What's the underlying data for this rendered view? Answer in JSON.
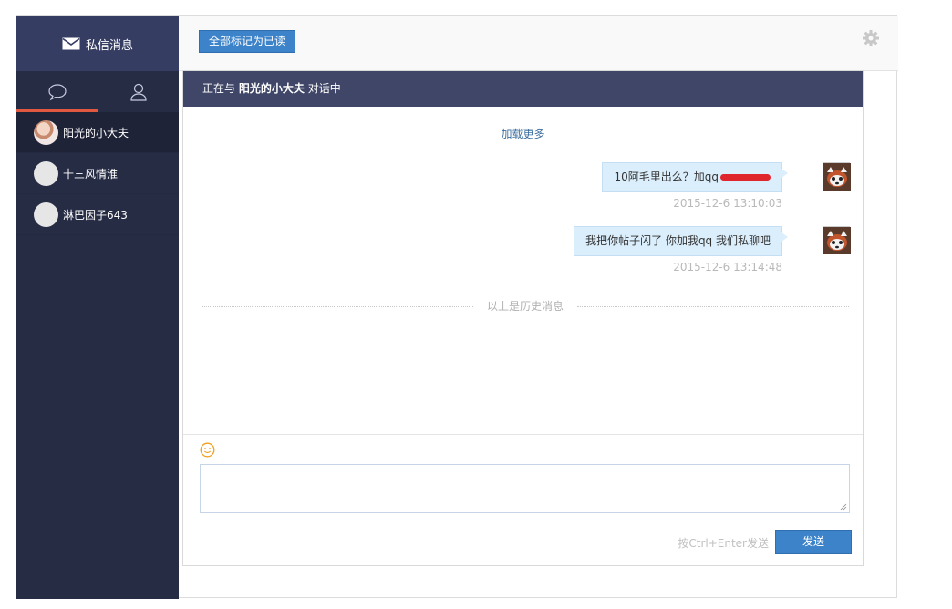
{
  "sidebar": {
    "title": "私信消息",
    "tabs": [
      {
        "icon": "chat-bubble-icon",
        "active": true
      },
      {
        "icon": "user-icon",
        "active": false
      }
    ],
    "contacts": [
      {
        "name": "阳光的小大夫",
        "active": true
      },
      {
        "name": "十三风情淮",
        "active": false
      },
      {
        "name": "淋巴因子643",
        "active": false
      }
    ]
  },
  "toolbar": {
    "mark_all_read": "全部标记为已读",
    "settings_icon": "gear-icon"
  },
  "chat": {
    "header_prefix": "正在与",
    "partner": "阳光的小大夫",
    "header_suffix": "对话中",
    "load_more": "加载更多",
    "messages": [
      {
        "text": "10阿毛里出么？加qq",
        "time": "2015-12-6 13:10:03",
        "redacted": true
      },
      {
        "text": "我把你帖子闪了 你加我qq 我们私聊吧",
        "time": "2015-12-6 13:14:48",
        "redacted": false
      }
    ],
    "history_divider": "以上是历史消息"
  },
  "compose": {
    "emoji_icon": "smiley-icon",
    "hint": "按Ctrl+Enter发送",
    "send_label": "发送"
  },
  "colors": {
    "sidebar_bg": "#272c45",
    "header_bg": "#3f4667",
    "accent": "#3d83c9",
    "tab_indicator": "#e0583f",
    "bubble_bg": "#dbeefc"
  }
}
